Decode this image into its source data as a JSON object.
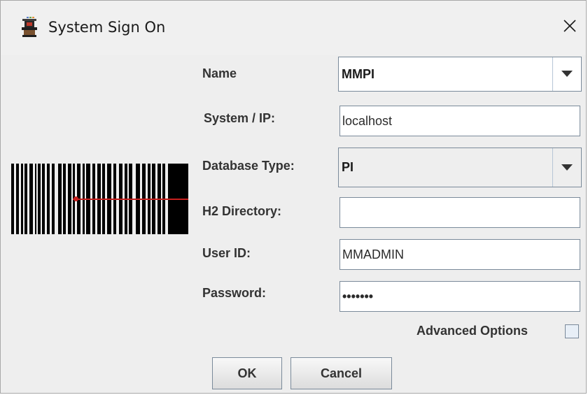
{
  "window": {
    "title": "System Sign On",
    "icon": "app-logo-icon",
    "close_icon": "close-icon"
  },
  "form": {
    "name": {
      "label": "Name",
      "value": "MMPI"
    },
    "system_ip": {
      "label": "System / IP:",
      "value": "localhost"
    },
    "database_type": {
      "label": "Database Type:",
      "value": "PI"
    },
    "h2_directory": {
      "label": "H2 Directory:",
      "value": ""
    },
    "user_id": {
      "label": "User ID:",
      "value": "MMADMIN"
    },
    "password": {
      "label": "Password:",
      "value": "•••••••"
    }
  },
  "advanced_options": {
    "label": "Advanced Options",
    "checked": false
  },
  "buttons": {
    "ok": "OK",
    "cancel": "Cancel"
  },
  "colors": {
    "dialog_bg": "#eeeeee",
    "field_border": "#7a8a9a",
    "barcode_scan_line": "#c8201e"
  }
}
